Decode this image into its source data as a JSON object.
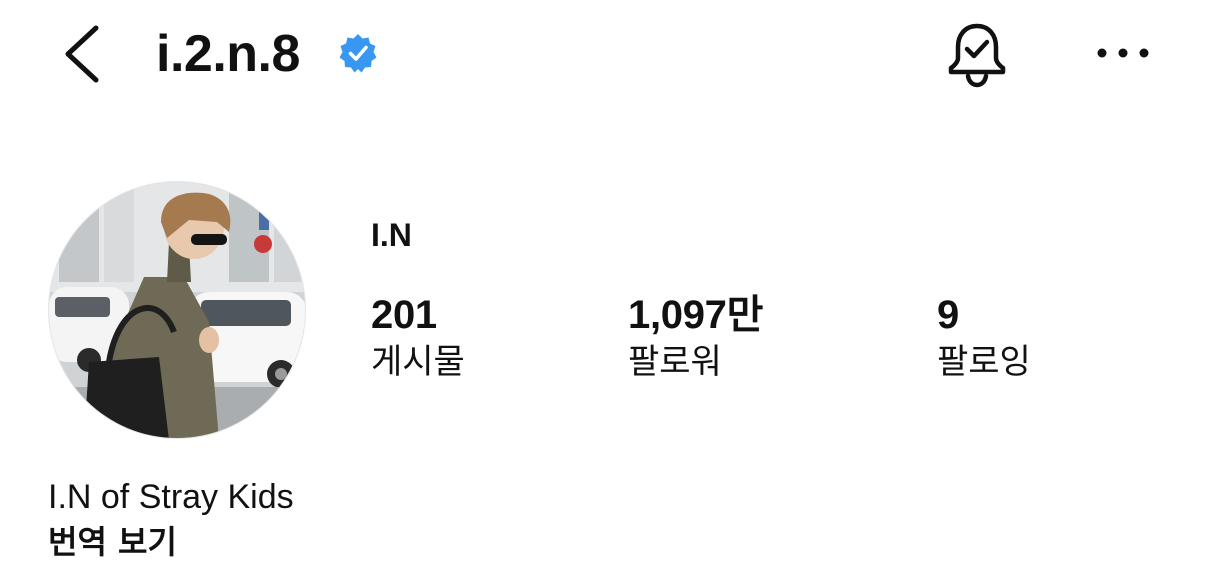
{
  "header": {
    "username": "i.2.n.8",
    "verified": true,
    "back_icon": "chevron-left-icon",
    "verified_icon": "verified-badge-icon",
    "notification_icon": "bell-check-icon",
    "more_icon": "more-horizontal-icon"
  },
  "profile": {
    "display_name": "I.N",
    "stats": [
      {
        "value": "201",
        "label": "게시물"
      },
      {
        "value": "1,097만",
        "label": "팔로워"
      },
      {
        "value": "9",
        "label": "팔로잉"
      }
    ],
    "bio": "I.N of Stray Kids",
    "translate_label": "번역 보기"
  },
  "colors": {
    "verified_blue": "#3897f0",
    "text": "#111111",
    "background": "#ffffff"
  }
}
